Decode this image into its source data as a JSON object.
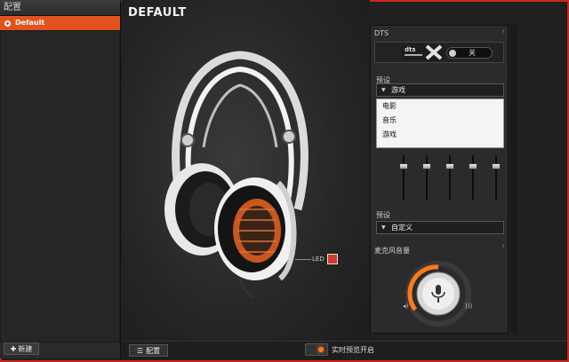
{
  "sidebar": {
    "header": "配置",
    "items": [
      {
        "label": "Default",
        "selected": true
      }
    ],
    "new_button": "新建"
  },
  "main": {
    "title": "DEFAULT",
    "led_label": "LED",
    "led_color": "#d33b2a"
  },
  "bottom_bar": {
    "config_button": "配置",
    "preview_label": "实时预览开启"
  },
  "dts": {
    "title": "DTS",
    "logo_text": "dts",
    "toggle_label": "关"
  },
  "preset": {
    "label": "预设",
    "selected": "游戏",
    "options": [
      "电影",
      "音乐",
      "游戏"
    ]
  },
  "eq_preset": {
    "label": "预设",
    "selected": "自定义"
  },
  "mic": {
    "title": "麦克风音量"
  },
  "colors": {
    "accent": "#e2521c",
    "border": "#c8281e"
  }
}
